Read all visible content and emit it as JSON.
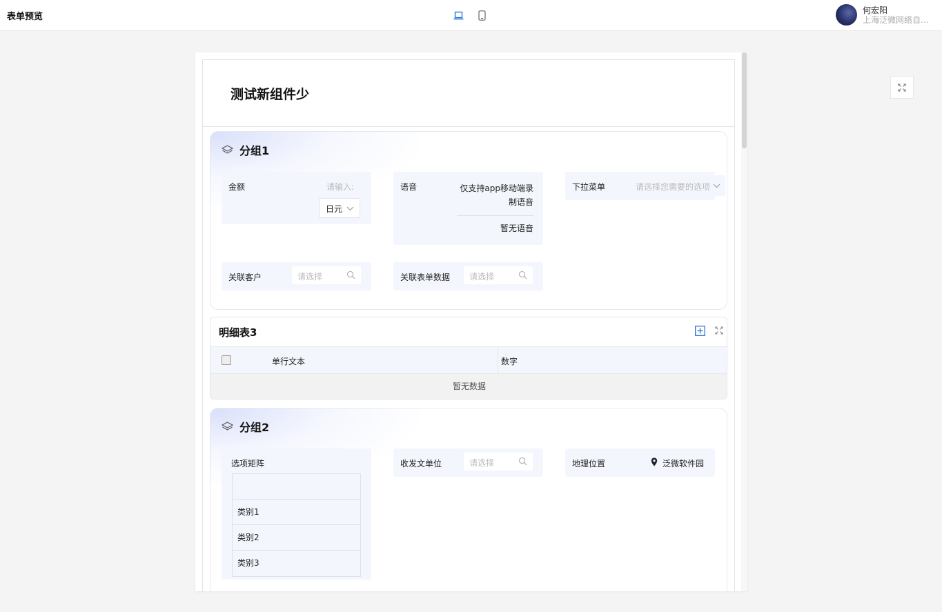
{
  "topbar": {
    "title": "表单预览",
    "user_name": "何宏阳",
    "user_org": "上海泛微网络自..."
  },
  "form": {
    "title": "测试新组件少"
  },
  "group1": {
    "title": "分组1",
    "amount": {
      "label": "金额",
      "placeholder": "请输入:",
      "unit": "日元"
    },
    "voice": {
      "label": "语音",
      "note": "仅支持app移动端录制语音",
      "empty": "暂无语音"
    },
    "dropdown": {
      "label": "下拉菜单",
      "placeholder": "请选择您需要的选项"
    },
    "customer": {
      "label": "关联客户",
      "placeholder": "请选择"
    },
    "related_form": {
      "label": "关联表单数据",
      "placeholder": "请选择"
    }
  },
  "detail_table": {
    "title": "明细表3",
    "columns": [
      "单行文本",
      "数字"
    ],
    "empty_text": "暂无数据"
  },
  "group2": {
    "title": "分组2",
    "matrix": {
      "label": "选项矩阵",
      "rows": [
        "",
        "类别1",
        "类别2",
        "类别3"
      ]
    },
    "dispatch": {
      "label": "收发文单位",
      "placeholder": "请选择"
    },
    "location": {
      "label": "地理位置",
      "value": "泛微软件园"
    }
  },
  "colors": {
    "accent": "#1a6bd6",
    "field_bg": "#f4f6fd",
    "placeholder": "#bbbbbb"
  }
}
